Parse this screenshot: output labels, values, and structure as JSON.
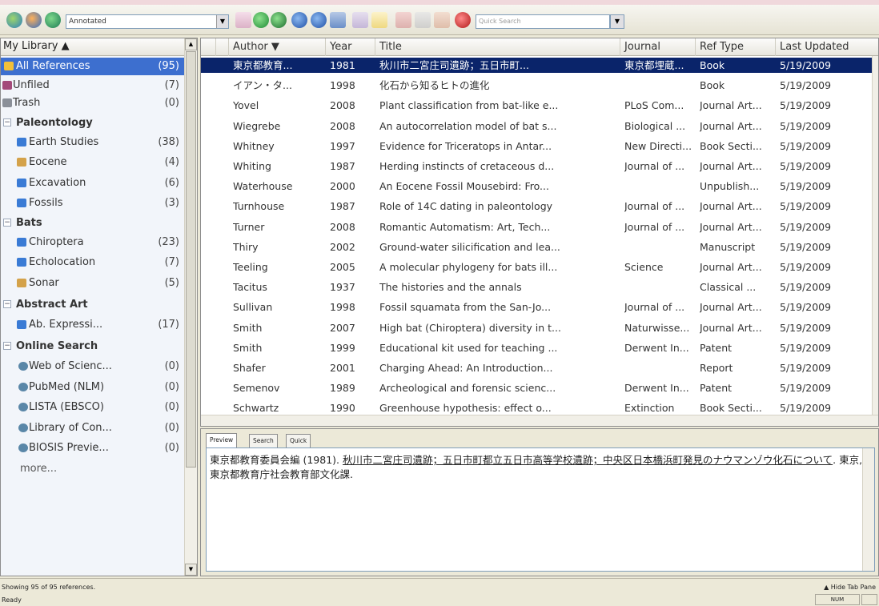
{
  "toolbar": {
    "style_select": "Annotated",
    "quick_search_placeholder": "Quick Search",
    "select_arrow": "▼",
    "icons": [
      "endnote-icon",
      "bats-icon",
      "globe-icon",
      "new-reference-icon",
      "cut-icon",
      "local-library-icon",
      "online-mode-icon",
      "integrated-icon",
      "find-full-text-icon",
      "online-search-icon",
      "open-link-icon",
      "insert-citation-icon",
      "format-bibliography-icon",
      "cwyw-icon",
      "export-icon",
      "help-icon"
    ]
  },
  "left_panel": {
    "header": "My Library  ▲",
    "items": [
      {
        "label": "All References",
        "count": "(95)",
        "selected": true
      },
      {
        "label": "Unfiled",
        "count": "(7)"
      },
      {
        "label": "Trash",
        "count": "(0)"
      }
    ],
    "groups": [
      {
        "name": "Paleontology",
        "items": [
          {
            "label": "Earth Studies",
            "count": "(38)"
          },
          {
            "label": "Eocene",
            "count": "(4)"
          },
          {
            "label": "Excavation",
            "count": "(6)"
          },
          {
            "label": "Fossils",
            "count": "(3)"
          }
        ]
      },
      {
        "name": "Bats",
        "items": [
          {
            "label": "Chiroptera",
            "count": "(23)"
          },
          {
            "label": "Echolocation",
            "count": "(7)"
          },
          {
            "label": "Sonar",
            "count": "(5)"
          }
        ]
      },
      {
        "name": "Abstract Art",
        "items": [
          {
            "label": "Ab. Expressi...",
            "count": "(17)"
          }
        ]
      },
      {
        "name": "Online Search",
        "items": [
          {
            "label": "Web of Scienc...",
            "count": "(0)"
          },
          {
            "label": "PubMed (NLM)",
            "count": "(0)"
          },
          {
            "label": "LISTA (EBSCO)",
            "count": "(0)"
          },
          {
            "label": "Library of Con...",
            "count": "(0)"
          },
          {
            "label": "BIOSIS Previe...",
            "count": "(0)"
          }
        ]
      }
    ],
    "more": "more...",
    "group_toggle": "−"
  },
  "table": {
    "columns": [
      "",
      "",
      "Author  ▼",
      "Year",
      "Title",
      "Journal",
      "Ref Type",
      "Last Updated"
    ],
    "rows": [
      {
        "author": "東京都教育...",
        "year": "1981",
        "title": "秋川市二宮庄司遺跡；五日市町...",
        "journal": "東京都埋蔵...",
        "reftype": "Book",
        "updated": "5/19/2009"
      },
      {
        "author": "イアン・タ...",
        "year": "1998",
        "title": "化石から知るヒトの進化",
        "journal": "",
        "reftype": "Book",
        "updated": "5/19/2009"
      },
      {
        "author": "Yovel",
        "year": "2008",
        "title": "Plant classification from bat-like e...",
        "journal": "PLoS Com...",
        "reftype": "Journal Art...",
        "updated": "5/19/2009"
      },
      {
        "author": "Wiegrebe",
        "year": "2008",
        "title": "An autocorrelation model of bat s...",
        "journal": "Biological ...",
        "reftype": "Journal Art...",
        "updated": "5/19/2009"
      },
      {
        "author": "Whitney",
        "year": "1997",
        "title": "Evidence for Triceratops in Antar...",
        "journal": "New Directi...",
        "reftype": "Book Secti...",
        "updated": "5/19/2009"
      },
      {
        "author": "Whiting",
        "year": "1987",
        "title": "Herding instincts of cretaceous d...",
        "journal": "Journal of ...",
        "reftype": "Journal Art...",
        "updated": "5/19/2009"
      },
      {
        "author": "Waterhouse",
        "year": "2000",
        "title": "An Eocene Fossil Mousebird: Fro...",
        "journal": "",
        "reftype": "Unpublish...",
        "updated": "5/19/2009"
      },
      {
        "author": "Turnhouse",
        "year": "1987",
        "title": "Role of 14C dating in paleontology",
        "journal": "Journal of ...",
        "reftype": "Journal Art...",
        "updated": "5/19/2009"
      },
      {
        "author": "Turner",
        "year": "2008",
        "title": "Romantic Automatism: Art, Tech...",
        "journal": "Journal of ...",
        "reftype": "Journal Art...",
        "updated": "5/19/2009"
      },
      {
        "author": "Thiry",
        "year": "2002",
        "title": "Ground-water silicification and lea...",
        "journal": "",
        "reftype": "Manuscript",
        "updated": "5/19/2009"
      },
      {
        "author": "Teeling",
        "year": "2005",
        "title": "A molecular phylogeny for bats ill...",
        "journal": "Science",
        "reftype": "Journal Art...",
        "updated": "5/19/2009"
      },
      {
        "author": "Tacitus",
        "year": "1937",
        "title": "The histories and the annals",
        "journal": "",
        "reftype": "Classical ...",
        "updated": "5/19/2009"
      },
      {
        "author": "Sullivan",
        "year": "1998",
        "title": "Fossil squamata from the San-Jo...",
        "journal": "Journal of ...",
        "reftype": "Journal Art...",
        "updated": "5/19/2009"
      },
      {
        "author": "Smith",
        "year": "2007",
        "title": "High bat (Chiroptera) diversity in t...",
        "journal": "Naturwisse...",
        "reftype": "Journal Art...",
        "updated": "5/19/2009"
      },
      {
        "author": "Smith",
        "year": "1999",
        "title": "Educational kit used for teaching ...",
        "journal": "Derwent In...",
        "reftype": "Patent",
        "updated": "5/19/2009"
      },
      {
        "author": "Shafer",
        "year": "2001",
        "title": "Charging Ahead: An Introduction...",
        "journal": "",
        "reftype": "Report",
        "updated": "5/19/2009"
      },
      {
        "author": "Semenov",
        "year": "1989",
        "title": "Archeological and forensic scienc...",
        "journal": "Derwent In...",
        "reftype": "Patent",
        "updated": "5/19/2009"
      },
      {
        "author": "Schwartz",
        "year": "1990",
        "title": "Greenhouse hypothesis: effect o...",
        "journal": "Extinction",
        "reftype": "Book Secti...",
        "updated": "5/19/2009"
      }
    ]
  },
  "tabs": [
    "Preview",
    "Search",
    "Quick Edit"
  ],
  "preview": {
    "author_part": "東京都教育委員会編 (1981).",
    "title_part": "秋川市二宮庄司遺跡；五日市町都立五日市高等学校遺跡；中央区日本橋浜町発見のナウマンゾウ化石について",
    "rest_part": ". 東京, 東京都教育庁社会教育部文化課."
  },
  "status": {
    "showing": "Showing 95 of 95 references.",
    "ready": "Ready",
    "hide_tab": "Hide Tab Pane",
    "hide_tab_icon": "▲",
    "num": "NUM"
  },
  "colors": {
    "selection_left": "#3d6fcf",
    "selection_row": "#0a246a",
    "folder": "#3a7bd5"
  }
}
